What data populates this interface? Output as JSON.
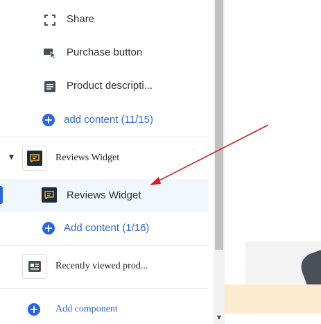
{
  "sections": {
    "items": [
      {
        "label": "Share",
        "icon": "share-icon"
      },
      {
        "label": "Purchase button",
        "icon": "purchase-button-icon"
      },
      {
        "label": "Product descripti...",
        "icon": "text-icon"
      }
    ],
    "add_content_1": "add content (11/15)",
    "reviews_section": {
      "label": "Reviews Widget",
      "icon": "review-widget-icon"
    },
    "reviews_block": {
      "label": "Reviews Widget",
      "icon": "review-widget-icon"
    },
    "add_content_2": "Add content (1/16)",
    "recently_viewed": {
      "label": "Recently viewed prod...",
      "icon": "recently-viewed-icon"
    },
    "add_component": "Add component"
  },
  "colors": {
    "accent": "#2b63e6",
    "selected_bg": "#f1f7ff",
    "arrow": "#d22020",
    "preview_band": "#fdebcf"
  }
}
